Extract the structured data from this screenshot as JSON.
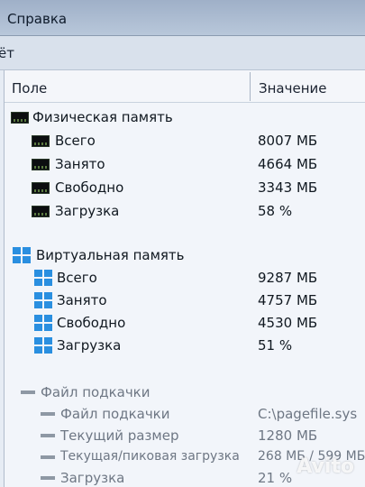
{
  "menu": {
    "help": "Справка"
  },
  "toolbar": {
    "label": "ёт"
  },
  "table": {
    "columns": {
      "field": "Поле",
      "value": "Значение"
    },
    "physical": {
      "title": "Физическая память",
      "rows": [
        {
          "label": "Всего",
          "value": "8007 МБ"
        },
        {
          "label": "Занято",
          "value": "4664 МБ"
        },
        {
          "label": "Свободно",
          "value": "3343 МБ"
        },
        {
          "label": "Загрузка",
          "value": "58 %"
        }
      ]
    },
    "virtual": {
      "title": "Виртуальная память",
      "rows": [
        {
          "label": "Всего",
          "value": "9287 МБ"
        },
        {
          "label": "Занято",
          "value": "4757 МБ"
        },
        {
          "label": "Свободно",
          "value": "4530 МБ"
        },
        {
          "label": "Загрузка",
          "value": "51 %"
        }
      ]
    },
    "pagefile": {
      "title": "Файл подкачки",
      "rows": [
        {
          "label": "Файл подкачки",
          "value": "C:\\pagefile.sys"
        },
        {
          "label": "Текущий размер",
          "value": "1280 МБ"
        },
        {
          "label": "Текущая/пиковая загрузка",
          "value": "268 МБ / 599 МБ"
        },
        {
          "label": "Загрузка",
          "value": "21 %"
        }
      ]
    }
  },
  "watermark": "Avito",
  "icons": {
    "memory": "memory-module-icon",
    "windows": "windows-logo-icon",
    "pagefile": "dash-icon"
  }
}
